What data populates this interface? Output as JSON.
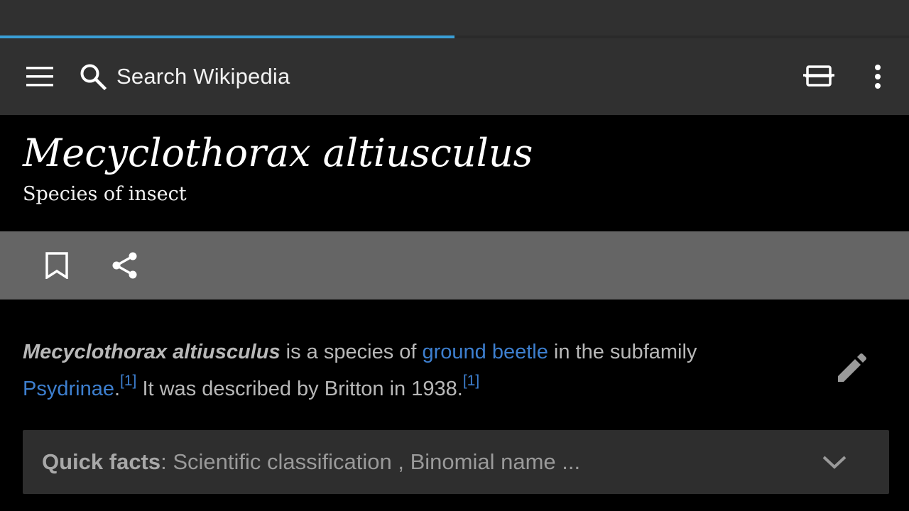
{
  "progress": {
    "fraction": 0.5,
    "color": "#3a9fd6"
  },
  "toolbar": {
    "menu_icon": "hamburger-menu-icon",
    "search_icon": "search-icon",
    "search_placeholder": "Search Wikipedia",
    "tabs_icon": "tabs-icon",
    "overflow_icon": "more-vert-icon"
  },
  "article": {
    "title": "Mecyclothorax altiusculus",
    "description": "Species of insect",
    "actions": {
      "bookmark_icon": "bookmark-icon",
      "share_icon": "share-icon"
    },
    "intro": {
      "bold_name": "Mecyclothorax altiusculus",
      "text_1": " is a species of ",
      "link_1": "ground beetle",
      "text_2": " in the subfamily ",
      "link_2": "Psydrinae",
      "text_3": ".",
      "ref_1": "[1]",
      "text_4": " It was described by Britton in 1938.",
      "ref_2": "[1]"
    },
    "edit_icon": "pencil-edit-icon",
    "quick_facts": {
      "label": "Quick facts",
      "summary": ": Scientific classification , Binomial name ...",
      "chevron_icon": "chevron-down-icon"
    }
  },
  "colors": {
    "toolbar_bg": "#303030",
    "action_bar_bg": "#656565",
    "link": "#3d7fcf",
    "body_text": "#b8b8b8"
  }
}
